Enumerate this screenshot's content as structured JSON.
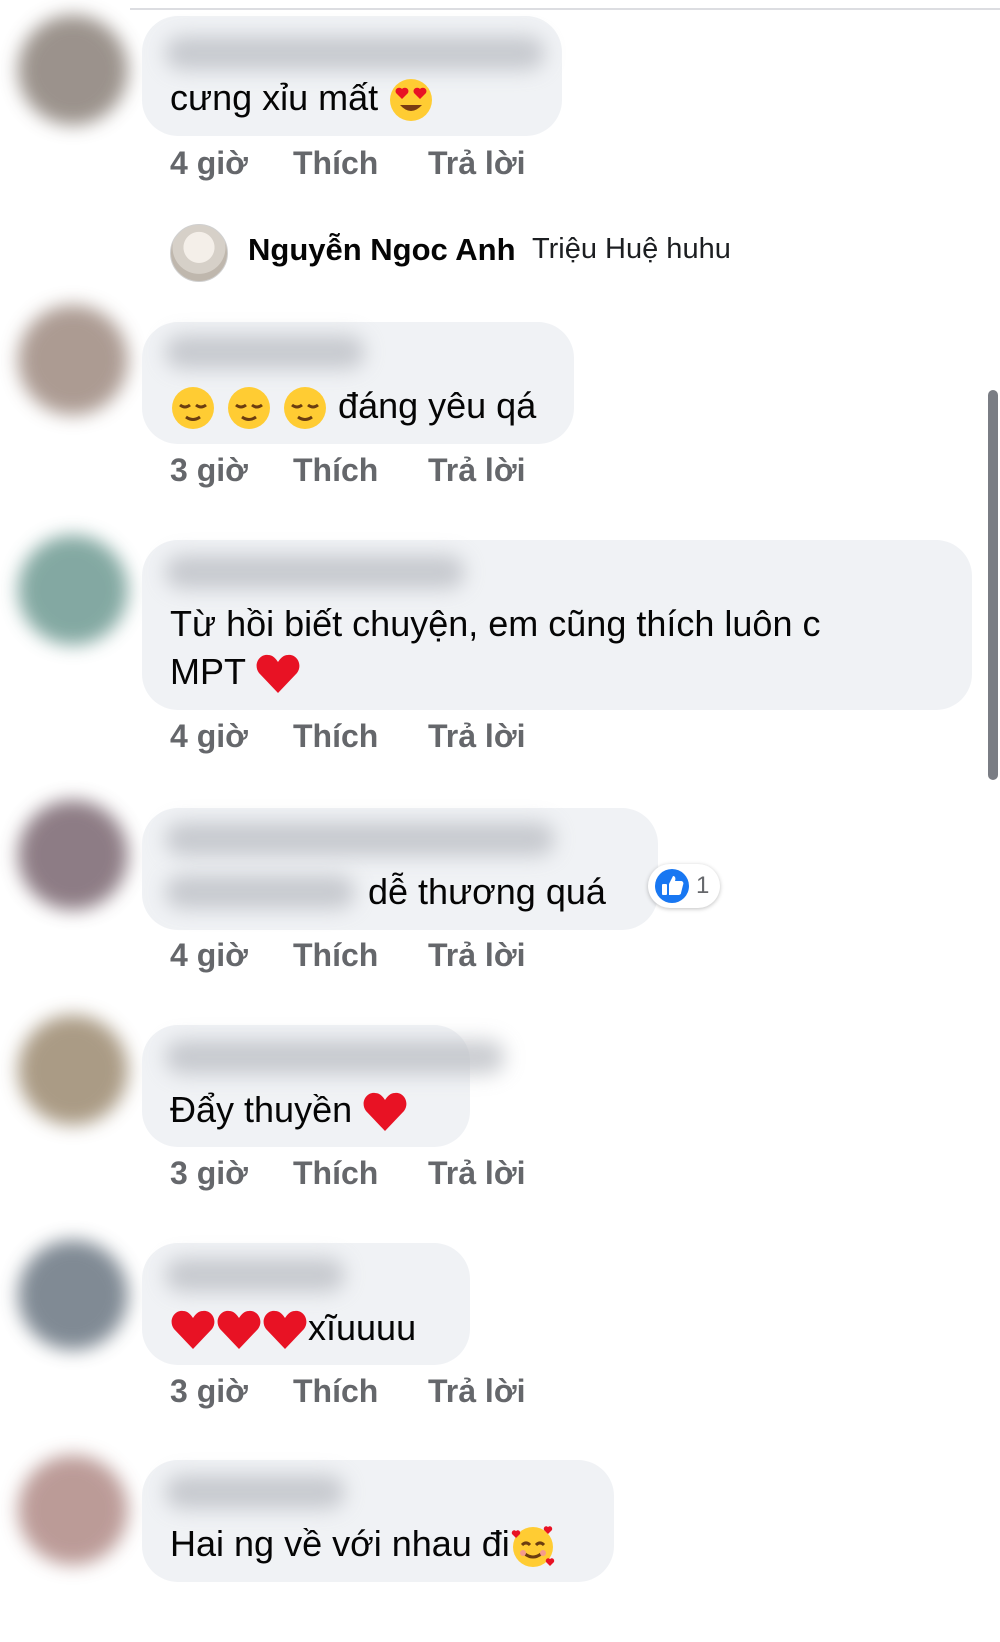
{
  "comments": [
    {
      "text": "cưng xỉu mất",
      "time": "4 giờ",
      "like": "Thích",
      "reply": "Trả lời"
    },
    {
      "text": "đáng yêu qá",
      "time": "3 giờ",
      "like": "Thích",
      "reply": "Trả lời"
    },
    {
      "text_line1": "Từ hồi biết chuyện, em cũng thích luôn c",
      "text_line2": "MPT",
      "time": "4 giờ",
      "like": "Thích",
      "reply": "Trả lời"
    },
    {
      "text": "dễ thương quá",
      "time": "4 giờ",
      "like": "Thích",
      "reply": "Trả lời",
      "reaction_count": "1"
    },
    {
      "text": "Đẩy thuyền",
      "time": "3 giờ",
      "like": "Thích",
      "reply": "Trả lời"
    },
    {
      "text": "xĩuuuu",
      "time": "3 giờ",
      "like": "Thích",
      "reply": "Trả lời"
    },
    {
      "text": "Hai ng về với nhau đi"
    }
  ],
  "reply_preview": {
    "name": "Nguyễn Ngoc Anh",
    "text": "Triệu Huệ huhu"
  },
  "colors": {
    "bubble": "#f0f2f5",
    "meta": "#65676b",
    "like_blue": "#1877f2",
    "heart": "#e81224"
  }
}
